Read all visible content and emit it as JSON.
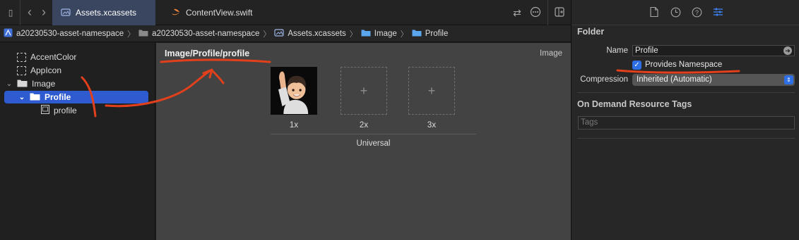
{
  "tabs": [
    {
      "label": "Assets.xcassets",
      "icon": "asset-catalog-icon"
    },
    {
      "label": "ContentView.swift",
      "icon": "swift-icon"
    }
  ],
  "breadcrumbs": [
    {
      "label": "a20230530-asset-namespace",
      "icon": "app-project-icon"
    },
    {
      "label": "a20230530-asset-namespace",
      "icon": "folder-icon"
    },
    {
      "label": "Assets.xcassets",
      "icon": "asset-catalog-icon"
    },
    {
      "label": "Image",
      "icon": "folder-icon"
    },
    {
      "label": "Profile",
      "icon": "folder-icon"
    }
  ],
  "navigator": {
    "items": [
      {
        "label": "AccentColor"
      },
      {
        "label": "AppIcon"
      },
      {
        "label": "Image"
      },
      {
        "label": "Profile"
      },
      {
        "label": "profile"
      }
    ]
  },
  "editor": {
    "title": "Image/Profile/profile",
    "type_label": "Image",
    "slots": [
      {
        "label": "1x",
        "filled": true
      },
      {
        "label": "2x",
        "filled": false
      },
      {
        "label": "3x",
        "filled": false
      }
    ],
    "empty_slot_glyph": "+",
    "group_label": "Universal"
  },
  "inspector": {
    "section_title": "Folder",
    "name_label": "Name",
    "name_value": "Profile",
    "provides_namespace_label": "Provides Namespace",
    "provides_namespace_checked": true,
    "compression_label": "Compression",
    "compression_value": "Inherited (Automatic)",
    "odr_title": "On Demand Resource Tags",
    "tags_placeholder": "Tags"
  },
  "colors": {
    "accent": "#2f6fe6",
    "selection": "#2f5bd0",
    "annotation": "#e2401c"
  }
}
